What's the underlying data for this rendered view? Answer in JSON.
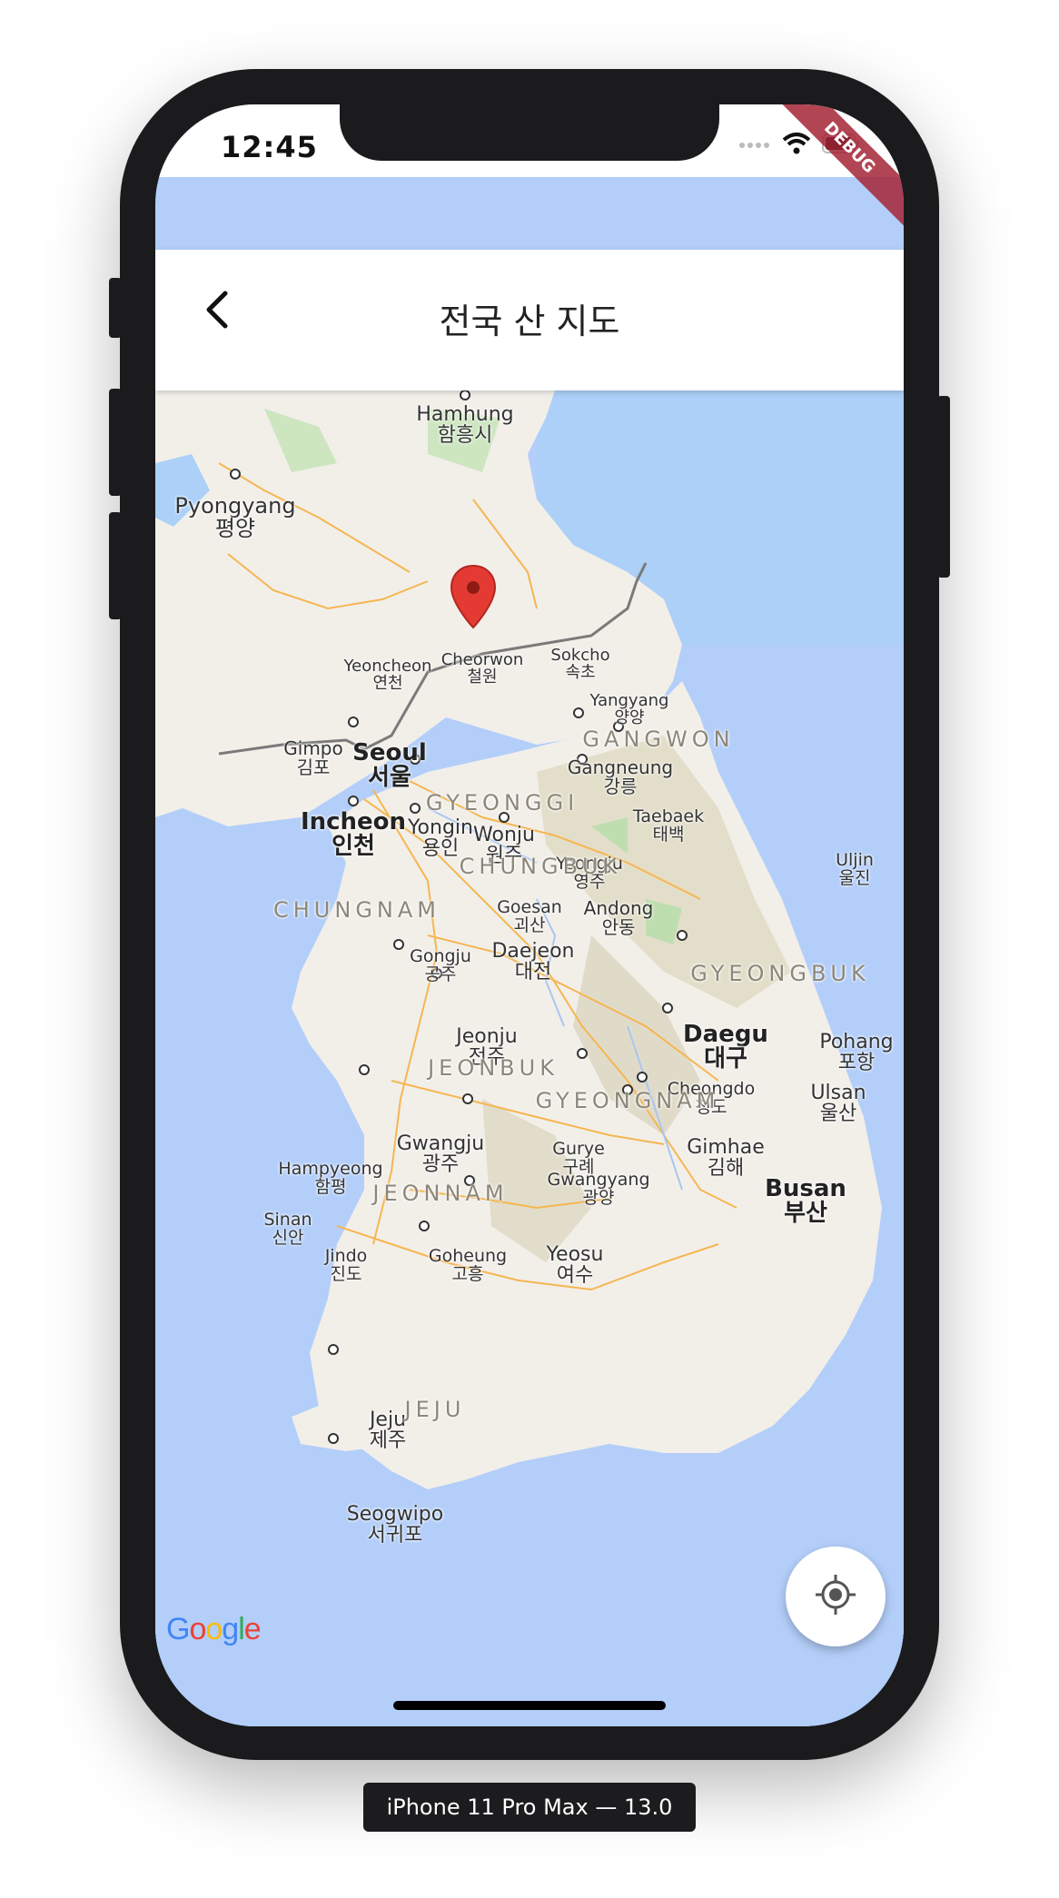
{
  "status_bar": {
    "time": "12:45",
    "debug_banner": "DEBUG"
  },
  "app_bar": {
    "title": "전국 산 지도",
    "back_icon": "chevron-left-icon"
  },
  "map": {
    "cities": [
      {
        "id": "hamhung",
        "en": "Hamhung",
        "ko": "함흥시"
      },
      {
        "id": "pyongyang",
        "en": "Pyongyang",
        "ko": "평양"
      },
      {
        "id": "yeoncheon",
        "en": "Yeoncheon",
        "ko": "연천"
      },
      {
        "id": "cheorwon",
        "en": "Cheorwon",
        "ko": "철원"
      },
      {
        "id": "sokcho",
        "en": "Sokcho",
        "ko": "속초"
      },
      {
        "id": "yangyang",
        "en": "Yangyang",
        "ko": "양양"
      },
      {
        "id": "gimpo",
        "en": "Gimpo",
        "ko": "김포"
      },
      {
        "id": "seoul",
        "en": "Seoul",
        "ko": "서울"
      },
      {
        "id": "gangneung",
        "en": "Gangneung",
        "ko": "강릉"
      },
      {
        "id": "incheon",
        "en": "Incheon",
        "ko": "인천"
      },
      {
        "id": "yongin",
        "en": "Yongin",
        "ko": "용인"
      },
      {
        "id": "wonju",
        "en": "Wonju",
        "ko": "원주"
      },
      {
        "id": "taebaek",
        "en": "Taebaek",
        "ko": "태백"
      },
      {
        "id": "yeongju",
        "en": "Yeongju",
        "ko": "영주"
      },
      {
        "id": "uljin",
        "en": "Uljin",
        "ko": "울진"
      },
      {
        "id": "goesan",
        "en": "Goesan",
        "ko": "괴산"
      },
      {
        "id": "andong",
        "en": "Andong",
        "ko": "안동"
      },
      {
        "id": "gongju",
        "en": "Gongju",
        "ko": "공주"
      },
      {
        "id": "daejeon",
        "en": "Daejeon",
        "ko": "대전"
      },
      {
        "id": "daegu",
        "en": "Daegu",
        "ko": "대구"
      },
      {
        "id": "jeonju",
        "en": "Jeonju",
        "ko": "전주"
      },
      {
        "id": "pohang",
        "en": "Pohang",
        "ko": "포항"
      },
      {
        "id": "cheongdo",
        "en": "Cheongdo",
        "ko": "청도"
      },
      {
        "id": "ulsan",
        "en": "Ulsan",
        "ko": "울산"
      },
      {
        "id": "gwangju",
        "en": "Gwangju",
        "ko": "광주"
      },
      {
        "id": "gurye",
        "en": "Gurye",
        "ko": "구례"
      },
      {
        "id": "gimhae",
        "en": "Gimhae",
        "ko": "김해"
      },
      {
        "id": "hampyeong",
        "en": "Hampyeong",
        "ko": "함평"
      },
      {
        "id": "gwangyang",
        "en": "Gwangyang",
        "ko": "광양"
      },
      {
        "id": "busan",
        "en": "Busan",
        "ko": "부산"
      },
      {
        "id": "sinan",
        "en": "Sinan",
        "ko": "신안"
      },
      {
        "id": "jindo",
        "en": "Jindo",
        "ko": "진도"
      },
      {
        "id": "goheung",
        "en": "Goheung",
        "ko": "고흥"
      },
      {
        "id": "yeosu",
        "en": "Yeosu",
        "ko": "여수"
      },
      {
        "id": "jeju",
        "en": "Jeju",
        "ko": "제주"
      },
      {
        "id": "seogwipo",
        "en": "Seogwipo",
        "ko": "서귀포"
      }
    ],
    "provinces": {
      "gangwon": "GANGWON",
      "gyeonggi": "GYEONGGI",
      "chungbuk": "CHUNGBUK",
      "chungnam": "CHUNGNAM",
      "gyeongbuk": "GYEONGBUK",
      "jeonbuk": "JEONBUK",
      "gyeongnam": "GYEONGNAM",
      "jeonnam": "JEONNAM",
      "jeju": "JEJU"
    },
    "attribution": "Google",
    "marker_icon": "map-pin-icon",
    "my_location_icon": "crosshair-location-icon"
  },
  "device_label": "iPhone 11 Pro Max — 13.0",
  "colors": {
    "marker": "#e33b33",
    "water": "#b3cef9",
    "land": "#f2efe9",
    "road": "#f6b651"
  }
}
